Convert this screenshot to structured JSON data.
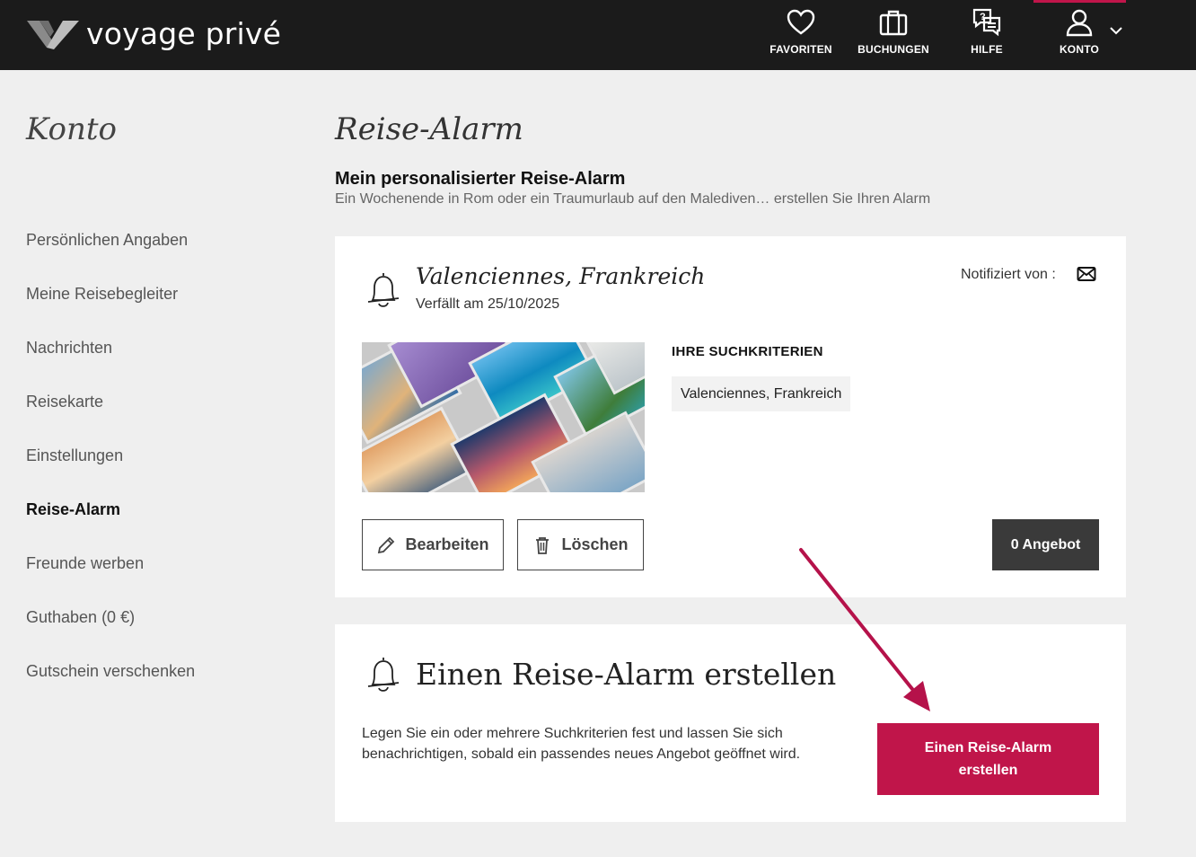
{
  "header": {
    "brand": "voyage privé",
    "nav": [
      {
        "label": "FAVORITEN",
        "icon": "heart-icon"
      },
      {
        "label": "BUCHUNGEN",
        "icon": "suitcase-icon"
      },
      {
        "label": "HILFE",
        "icon": "help-chat-icon"
      },
      {
        "label": "KONTO",
        "icon": "user-icon"
      }
    ],
    "active_color": "#c0154a"
  },
  "sidebar": {
    "title": "Konto",
    "items": [
      {
        "label": "Persönlichen Angaben"
      },
      {
        "label": "Meine Reisebegleiter"
      },
      {
        "label": "Nachrichten"
      },
      {
        "label": "Reisekarte"
      },
      {
        "label": "Einstellungen"
      },
      {
        "label": "Reise-Alarm",
        "active": true
      },
      {
        "label": "Freunde werben"
      },
      {
        "label": "Guthaben (0 €)"
      },
      {
        "label": "Gutschein verschenken"
      }
    ]
  },
  "main": {
    "title": "Reise-Alarm",
    "section_title": "Mein personalisierter Reise-Alarm",
    "section_subtitle": "Ein Wochenende in Rom oder ein Traumurlaub auf den Malediven… erstellen Sie Ihren Alarm",
    "alarm": {
      "place": "Valenciennes, Frankreich",
      "expires": "Verfällt am 25/10/2025",
      "notified_by": "Notifiziert von :",
      "criteria_title": "IHRE SUCHKRITERIEN",
      "criteria": [
        "Valenciennes, Frankreich"
      ],
      "edit_label": "Bearbeiten",
      "delete_label": "Löschen",
      "offers_label": "0 Angebot"
    },
    "create": {
      "title": "Einen Reise-Alarm erstellen",
      "text": "Legen Sie ein oder mehrere Suchkriterien fest und lassen Sie sich benachrichtigen, sobald ein passendes neues Angebot geöffnet wird.",
      "button_label": "Einen Reise-Alarm erstellen"
    }
  }
}
